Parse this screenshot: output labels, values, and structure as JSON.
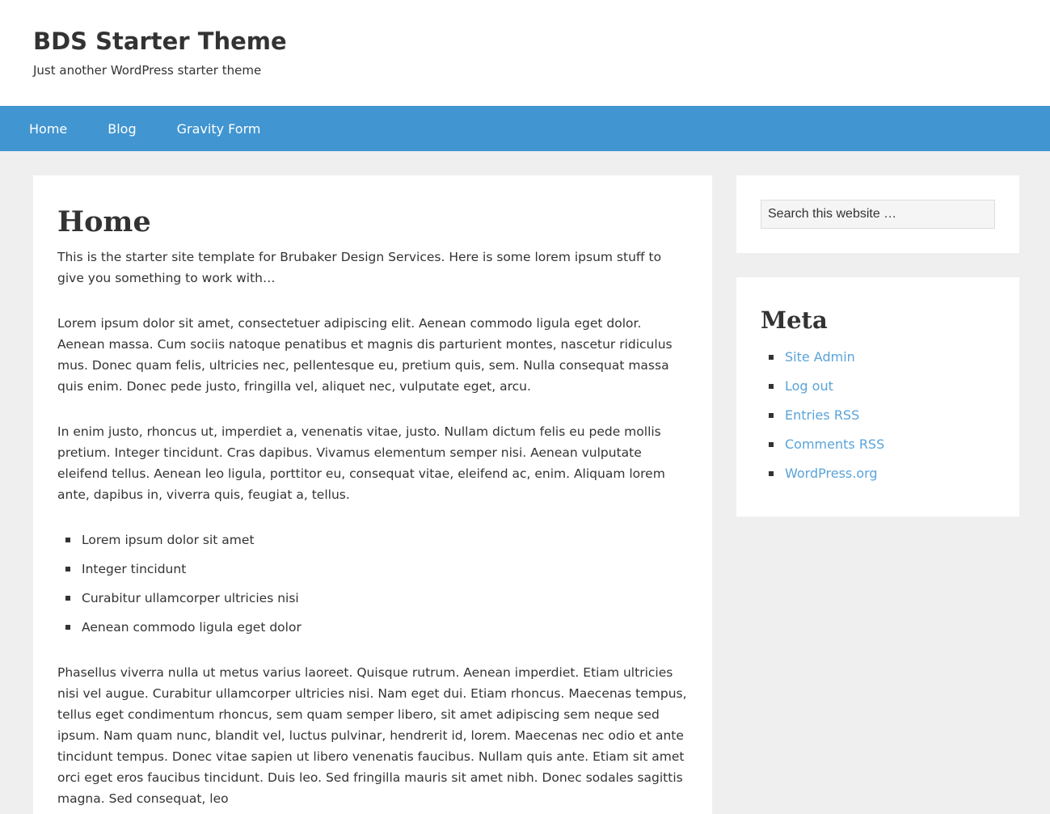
{
  "header": {
    "site_title": "BDS Starter Theme",
    "site_description": "Just another WordPress starter theme"
  },
  "nav": {
    "items": [
      {
        "label": "Home"
      },
      {
        "label": "Blog"
      },
      {
        "label": "Gravity Form"
      }
    ]
  },
  "main": {
    "title": "Home",
    "intro": "This is the starter site template for Brubaker Design Services. Here is some lorem ipsum stuff to give you something to work with…",
    "paragraph1": "Lorem ipsum dolor sit amet, consectetuer adipiscing elit. Aenean commodo ligula eget dolor. Aenean massa. Cum sociis natoque penatibus et magnis dis parturient montes, nascetur ridiculus mus. Donec quam felis, ultricies nec, pellentesque eu, pretium quis, sem. Nulla consequat massa quis enim. Donec pede justo, fringilla vel, aliquet nec, vulputate eget, arcu.",
    "paragraph2": "In enim justo, rhoncus ut, imperdiet a, venenatis vitae, justo. Nullam dictum felis eu pede mollis pretium. Integer tincidunt. Cras dapibus. Vivamus elementum semper nisi. Aenean vulputate eleifend tellus. Aenean leo ligula, porttitor eu, consequat vitae, eleifend ac, enim. Aliquam lorem ante, dapibus in, viverra quis, feugiat a, tellus.",
    "list": [
      "Lorem ipsum dolor sit amet",
      "Integer tincidunt",
      "Curabitur ullamcorper ultricies nisi",
      "Aenean commodo ligula eget dolor"
    ],
    "paragraph3": "Phasellus viverra nulla ut metus varius laoreet. Quisque rutrum. Aenean imperdiet. Etiam ultricies nisi vel augue. Curabitur ullamcorper ultricies nisi. Nam eget dui. Etiam rhoncus. Maecenas tempus, tellus eget condimentum rhoncus, sem quam semper libero, sit amet adipiscing sem neque sed ipsum. Nam quam nunc, blandit vel, luctus pulvinar, hendrerit id, lorem. Maecenas nec odio et ante tincidunt tempus. Donec vitae sapien ut libero venenatis faucibus. Nullam quis ante. Etiam sit amet orci eget eros faucibus tincidunt. Duis leo. Sed fringilla mauris sit amet nibh. Donec sodales sagittis magna. Sed consequat, leo"
  },
  "sidebar": {
    "search": {
      "placeholder": "Search this website …"
    },
    "meta": {
      "title": "Meta",
      "links": [
        "Site Admin",
        "Log out",
        "Entries RSS",
        "Comments RSS",
        "WordPress.org"
      ]
    }
  },
  "colors": {
    "nav_bg": "#4195d0",
    "link": "#5aa3d8",
    "page_bg": "#efefef",
    "text": "#333333"
  }
}
